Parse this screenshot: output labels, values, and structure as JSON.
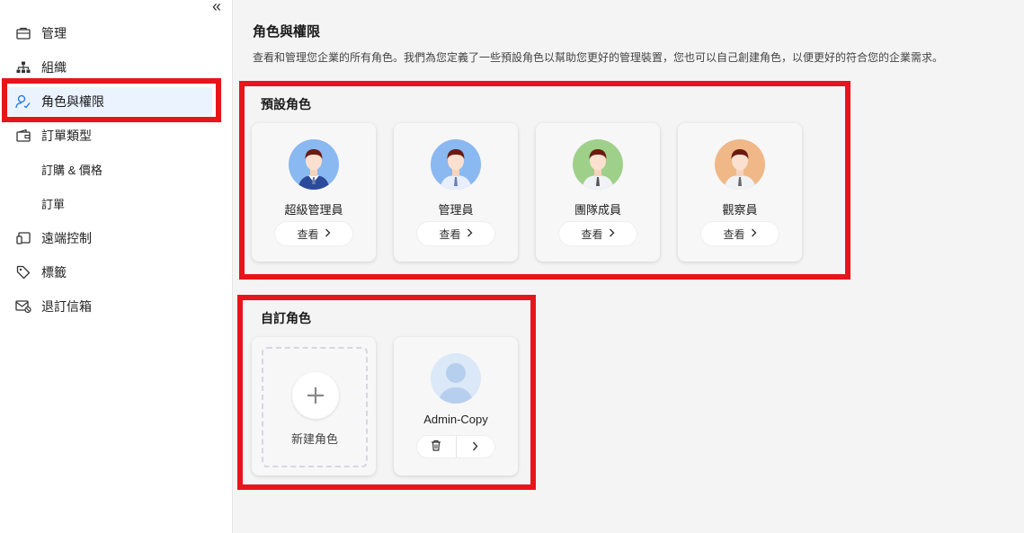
{
  "sidebar": {
    "collapse_glyph": "«",
    "items": [
      {
        "label": "管理",
        "icon": "briefcase-icon"
      },
      {
        "label": "組織",
        "icon": "org-tree-icon"
      },
      {
        "label": "角色與權限",
        "icon": "user-role-icon",
        "active": true
      },
      {
        "label": "訂單類型",
        "icon": "wallet-icon"
      },
      {
        "label": "訂購 & 價格"
      },
      {
        "label": "訂單"
      },
      {
        "label": "遠端控制",
        "icon": "remote-icon"
      },
      {
        "label": "標籤",
        "icon": "tag-icon"
      },
      {
        "label": "退訂信箱",
        "icon": "mail-icon"
      }
    ]
  },
  "main": {
    "title": "角色與權限",
    "description": "查看和管理您企業的所有角色。我們為您定義了一些預設角色以幫助您更好的管理裝置，您也可以自己創建角色，以便更好的符合您的企業需求。"
  },
  "preset": {
    "title": "預設角色",
    "roles": [
      {
        "name": "超級管理員",
        "view_label": "查看",
        "avatar_bg": "#8ab8f0",
        "suit": "#2c4a9a"
      },
      {
        "name": "管理員",
        "view_label": "查看",
        "avatar_bg": "#8ab8f0",
        "suit": "#e8eefc"
      },
      {
        "name": "團隊成員",
        "view_label": "查看",
        "avatar_bg": "#9fd08a",
        "suit": "#f0f2f5"
      },
      {
        "name": "觀察員",
        "view_label": "查看",
        "avatar_bg": "#f0b887",
        "suit": "#f0f2f5"
      }
    ]
  },
  "custom": {
    "title": "自訂角色",
    "new_label": "新建角色",
    "roles": [
      {
        "name": "Admin-Copy"
      }
    ]
  },
  "colors": {
    "highlight": "#e8141c",
    "active_bg": "#eaf3ff",
    "accent": "#1a73e8"
  }
}
